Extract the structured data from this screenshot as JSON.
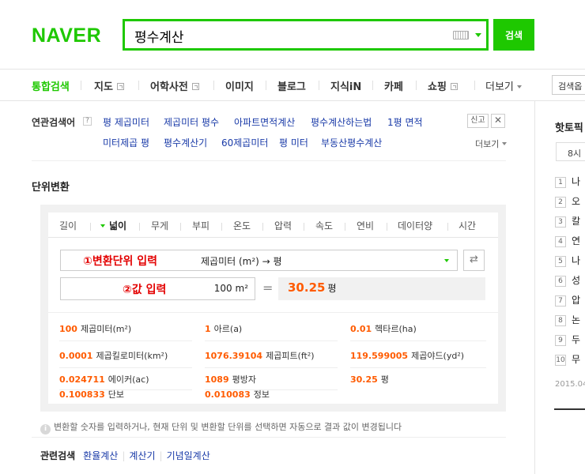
{
  "header": {
    "logo": "NAVER",
    "search_value": "평수계산",
    "search_button": "검색"
  },
  "nav": {
    "items": [
      {
        "label": "통합검색",
        "active": true
      },
      {
        "label": "지도",
        "ext": true
      },
      {
        "label": "어학사전",
        "ext": true
      },
      {
        "label": "이미지"
      },
      {
        "label": "블로그"
      },
      {
        "label": "지식iN"
      },
      {
        "label": "카페"
      },
      {
        "label": "쇼핑",
        "ext": true
      },
      {
        "label": "더보기"
      }
    ],
    "option_label": "검색옵"
  },
  "related": {
    "title": "연관검색어",
    "help": "?",
    "row1": [
      "평 제곱미터",
      "제곱미터 평수",
      "아파트면적계산",
      "평수계산하는법",
      "1평 면적"
    ],
    "row2": [
      "미터제곱 평",
      "평수계산기",
      "60제곱미터",
      "평 미터",
      "부동산평수계산"
    ],
    "report": "신고",
    "close": "✕",
    "more": "더보기"
  },
  "converter": {
    "section_title": "단위변환",
    "tabs": [
      "길이",
      "넓이",
      "무게",
      "부피",
      "온도",
      "압력",
      "속도",
      "연비",
      "데이터양",
      "시간"
    ],
    "active_tab": "넓이",
    "unit_selection": "제곱미터 (m²) → 평",
    "swap": "⇄",
    "input_value": "100",
    "input_unit": "m²",
    "equals": "=",
    "result_value": "30.25",
    "result_unit": "평",
    "annotation_1": "①변환단위 입력",
    "annotation_2": "②값 입력",
    "results": [
      {
        "value": "100",
        "unit": "제곱미터(m²)"
      },
      {
        "value": "1",
        "unit": "아르(a)"
      },
      {
        "value": "0.01",
        "unit": "헥타르(ha)"
      },
      {
        "value": "0.0001",
        "unit": "제곱킬로미터(km²)"
      },
      {
        "value": "1076.39104",
        "unit": "제곱피트(ft²)"
      },
      {
        "value": "119.599005",
        "unit": "제곱야드(yd²)"
      },
      {
        "value": "0.024711",
        "unit": "에이커(ac)"
      },
      {
        "value": "1089",
        "unit": "평방자"
      },
      {
        "value": "30.25",
        "unit": "평"
      },
      {
        "value": "0.100833",
        "unit": "단보"
      },
      {
        "value": "0.010083",
        "unit": "정보"
      }
    ],
    "info": "변환할 숫자를 입력하거나, 현재 단위 및 변환할 단위를 선택하면 자동으로 결과 값이 변경됩니다",
    "info_icon": "i"
  },
  "bottom_related": {
    "title": "관련검색",
    "links": [
      "환율계산",
      "계산기",
      "기념일계산"
    ]
  },
  "hot": {
    "title": "핫토픽",
    "time": "8시",
    "ranks": [
      {
        "n": "1",
        "kw": "나"
      },
      {
        "n": "2",
        "kw": "오"
      },
      {
        "n": "3",
        "kw": "칼"
      },
      {
        "n": "4",
        "kw": "연"
      },
      {
        "n": "5",
        "kw": "나"
      },
      {
        "n": "6",
        "kw": "성"
      },
      {
        "n": "7",
        "kw": "압"
      },
      {
        "n": "8",
        "kw": "논"
      },
      {
        "n": "9",
        "kw": "두"
      },
      {
        "n": "10",
        "kw": "무"
      }
    ],
    "date": "2015.04."
  },
  "colors": {
    "brand": "#1ec800",
    "result": "#ff5b00",
    "link": "#1a3ba8",
    "annotation": "#e30000"
  }
}
